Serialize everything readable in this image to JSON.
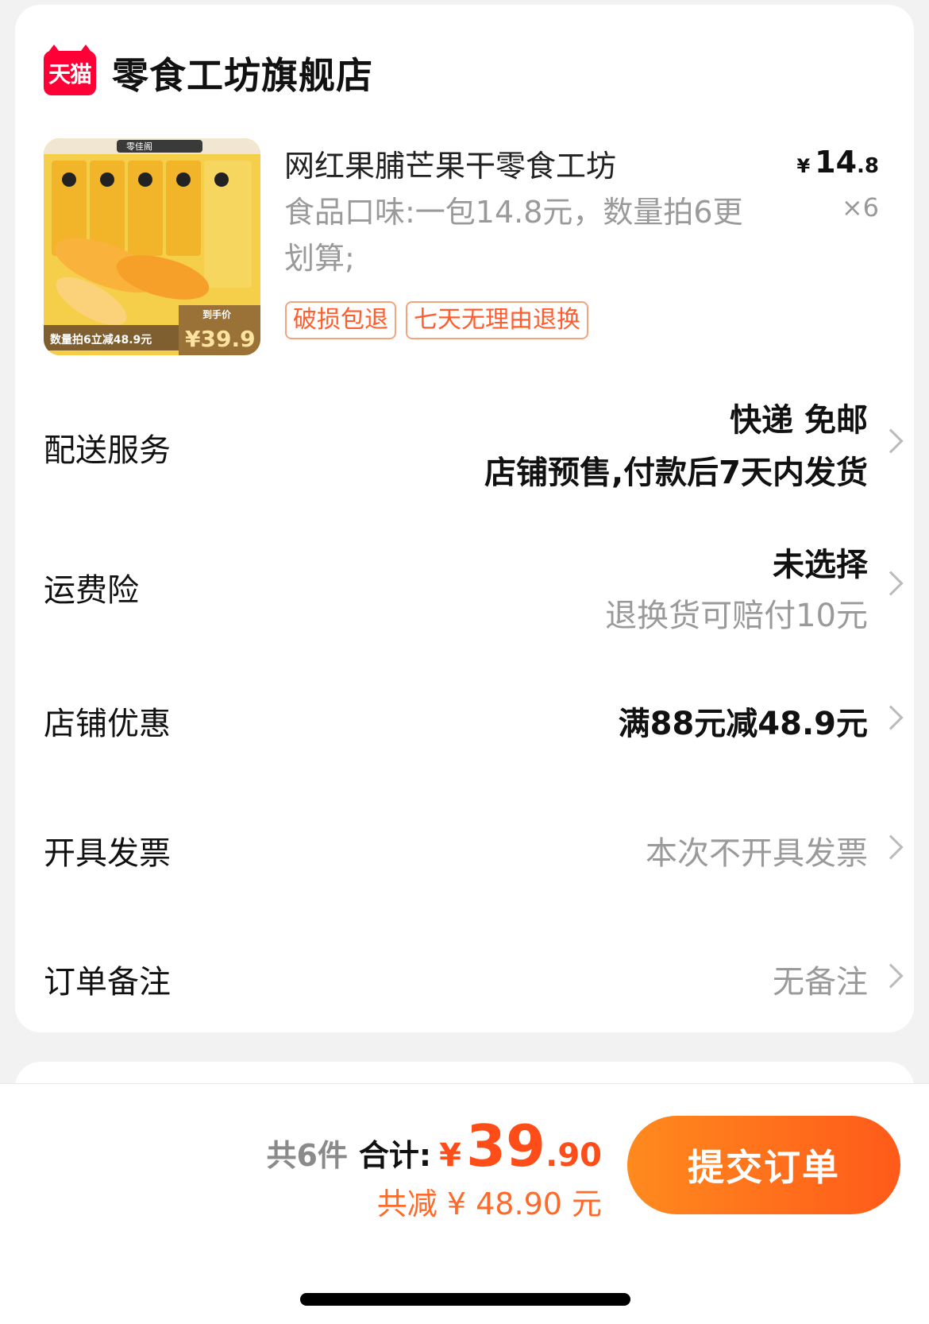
{
  "store": {
    "badge_text": "天猫",
    "name": "零食工坊旗舰店"
  },
  "product": {
    "title": "网红果脯芒果干零食工坊",
    "spec": "食品口味:一包14.8元，数量拍6更划算;",
    "price_symbol": "¥",
    "price_int": "14",
    "price_dec": ".8",
    "quantity": "×6",
    "tags": [
      "破损包退",
      "七天无理由退换"
    ],
    "image_text": {
      "brand": "零佳阁",
      "promo": "数量拍6立减48.9元",
      "hand_price_label": "到手价",
      "hand_price": "¥39.9"
    }
  },
  "rows": {
    "delivery": {
      "label": "配送服务",
      "value_line1": "快递 免邮",
      "value_line2": "店铺预售,付款后7天内发货"
    },
    "shipping_insurance": {
      "label": "运费险",
      "value_line1": "未选择",
      "value_line2": "退换货可赔付10元"
    },
    "store_discount": {
      "label": "店铺优惠",
      "value": "满88元减48.9元"
    },
    "invoice": {
      "label": "开具发票",
      "value": "本次不开具发票"
    },
    "order_note": {
      "label": "订单备注",
      "value": "无备注"
    }
  },
  "footer": {
    "count_text": "共6件",
    "sum_label": "合计:",
    "sum_symbol": "¥",
    "sum_int": "39",
    "sum_dec": ".90",
    "saving_text": "共减 ¥ 48.90 元",
    "submit_label": "提交订单"
  },
  "colors": {
    "accent": "#ff4d1a",
    "tag_border": "#f4a37c",
    "tmall_red": "#ff0036",
    "button_gradient_start": "#ff8a1e",
    "button_gradient_end": "#ff5a1a"
  }
}
